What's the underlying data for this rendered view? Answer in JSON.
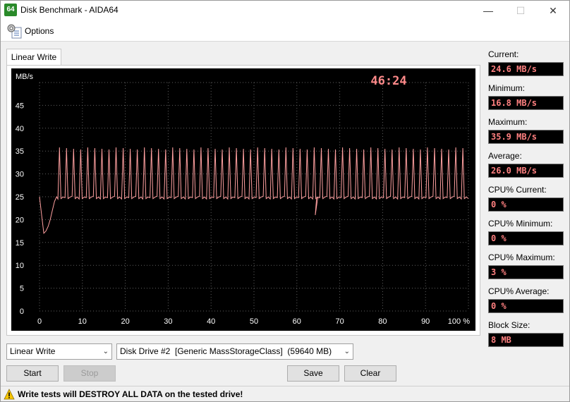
{
  "window": {
    "title": "Disk Benchmark - AIDA64",
    "app_icon_text": "64"
  },
  "menu": {
    "options_label": "Options"
  },
  "tab": {
    "label": "Linear Write"
  },
  "chart_data": {
    "type": "line",
    "title": "",
    "ylabel": "MB/s",
    "xlabel": "",
    "timer": "46:24",
    "ylim": [
      0,
      50
    ],
    "xlim": [
      0,
      100
    ],
    "y_ticks": [
      "0",
      "5",
      "10",
      "15",
      "20",
      "25",
      "30",
      "35",
      "40",
      "45"
    ],
    "x_ticks": [
      "0",
      "10",
      "20",
      "30",
      "40",
      "50",
      "60",
      "70",
      "80",
      "90",
      "100 %"
    ],
    "line_color": "#ffa0a0",
    "grid": true,
    "series": [
      {
        "x": [
          0.0,
          0.5,
          1.0,
          1.5,
          2.0,
          2.5,
          3.0,
          3.5,
          4.0
        ],
        "y": [
          25.0,
          21.0,
          17.0,
          17.5,
          18.5,
          20.0,
          22.0,
          24.0,
          25.0
        ]
      }
    ],
    "spike_pattern": {
      "start_x": 4.3,
      "end_x": 99.5,
      "interval_x": 1.65,
      "base_y": 24.8,
      "peak_y": 35.8,
      "dip_x": 64.3,
      "dip_y": 21.0
    }
  },
  "stats": [
    {
      "label": "Current:",
      "value": "24.6 MB/s"
    },
    {
      "label": "Minimum:",
      "value": "16.8 MB/s"
    },
    {
      "label": "Maximum:",
      "value": "35.9 MB/s"
    },
    {
      "label": "Average:",
      "value": "26.0 MB/s"
    },
    {
      "label": "CPU% Current:",
      "value": "0 %"
    },
    {
      "label": "CPU% Minimum:",
      "value": "0 %"
    },
    {
      "label": "CPU% Maximum:",
      "value": "3 %"
    },
    {
      "label": "CPU% Average:",
      "value": "0 %"
    },
    {
      "label": "Block Size:",
      "value": "8 MB"
    }
  ],
  "controls": {
    "test_select": "Linear Write",
    "drive_select": "Disk Drive #2  [Generic MassStorageClass]  (59640 MB)",
    "start_label": "Start",
    "stop_label": "Stop",
    "save_label": "Save",
    "clear_label": "Clear"
  },
  "status": {
    "warning_text": "Write tests will DESTROY ALL DATA on the tested drive!"
  }
}
